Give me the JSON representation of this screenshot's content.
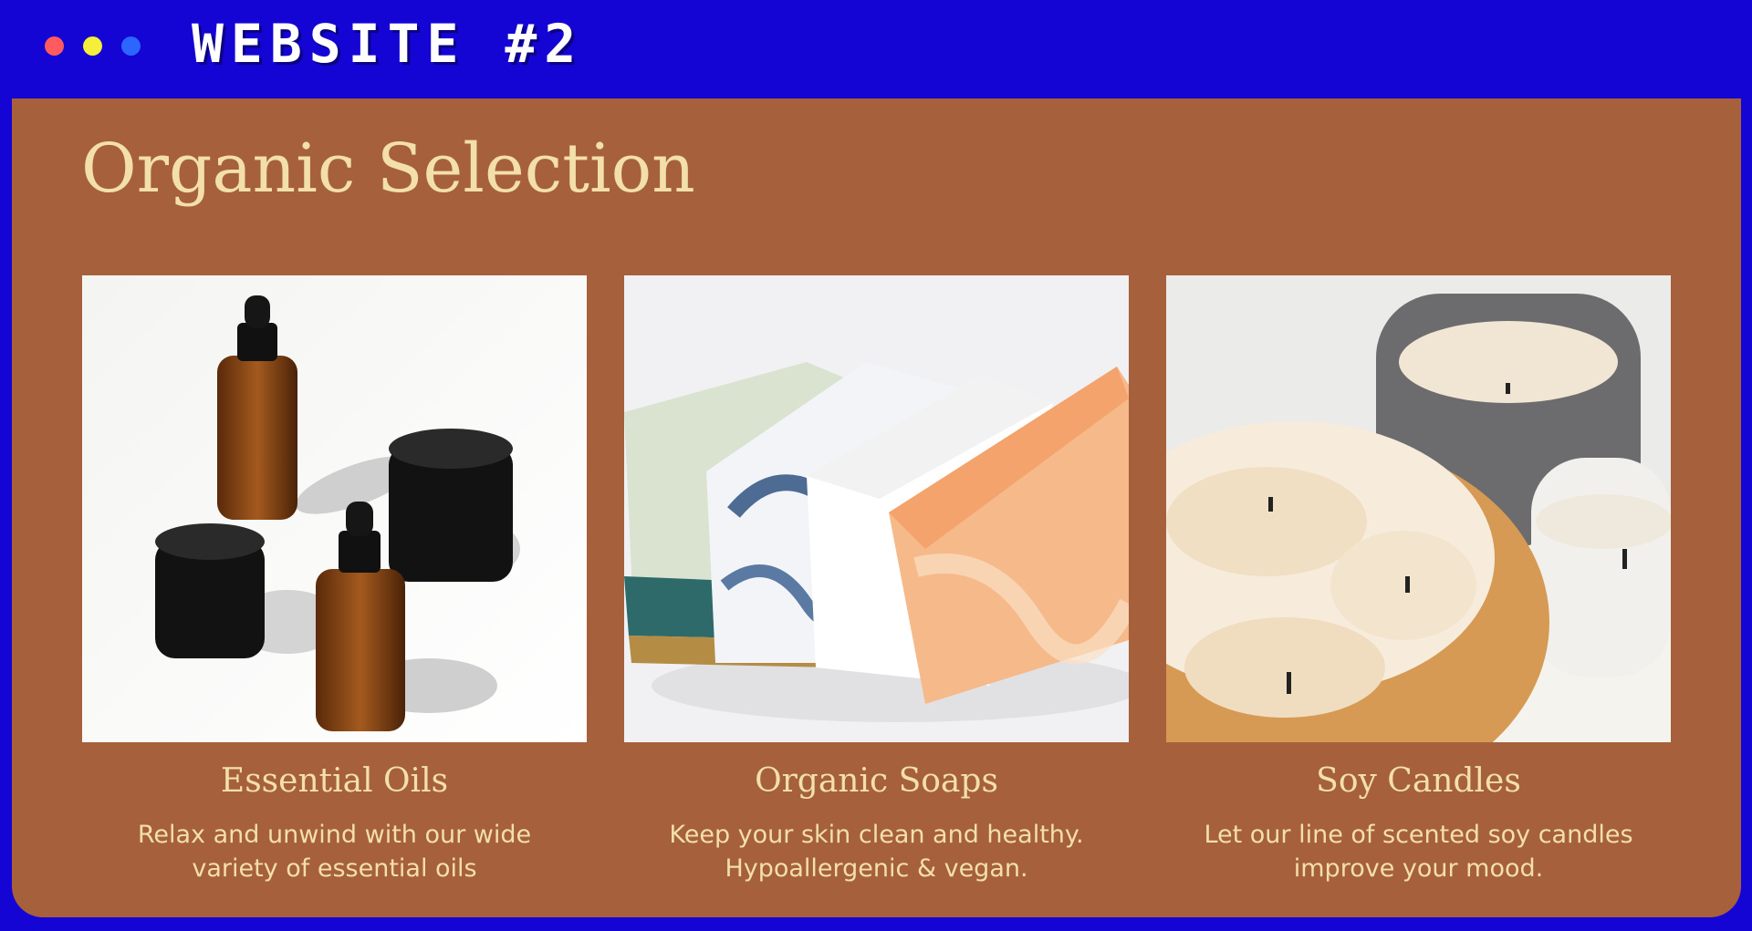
{
  "window": {
    "title": "WEBSITE #2",
    "controls": [
      "close-dot",
      "minimize-dot",
      "maximize-dot"
    ]
  },
  "page": {
    "heading": "Organic Selection",
    "products": [
      {
        "image": "essential-oils-photo",
        "title": "Essential Oils",
        "description_lines": [
          "Relax and unwind with our wide",
          "variety of essential oils"
        ]
      },
      {
        "image": "organic-soaps-photo",
        "title": "Organic Soaps",
        "description_lines": [
          "Keep your skin clean and healthy.",
          "Hypoallergenic & vegan."
        ]
      },
      {
        "image": "soy-candles-photo",
        "title": "Soy Candles",
        "description_lines": [
          "Let our line of scented soy candles",
          "improve your mood."
        ]
      }
    ]
  },
  "colors": {
    "frame": "#1405d4",
    "content_background": "#a6603b",
    "text": "#f2dfaa",
    "dot_red": "#ff5a5f",
    "dot_yellow": "#f5ef3b",
    "dot_blue": "#2a66ff"
  }
}
